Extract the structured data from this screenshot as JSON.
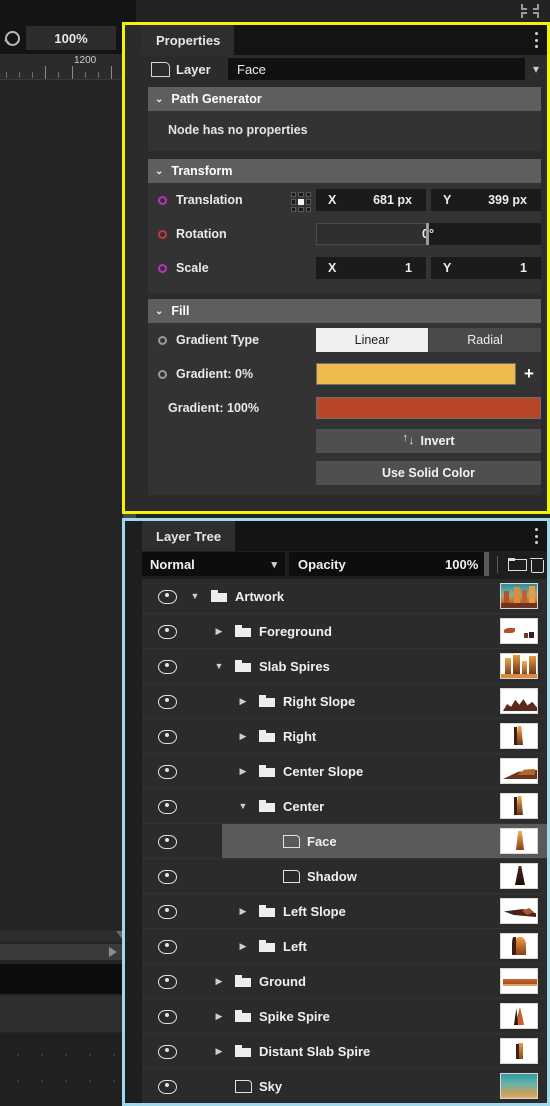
{
  "canvas": {
    "zoom_value": "100%",
    "zoom_icon": "magnifier-icon",
    "ruler_label": "1200",
    "collapse_icon": "collapse-corners-icon"
  },
  "properties_panel": {
    "tab_label": "Properties",
    "menu_icon": "kebab-menu-icon",
    "layer_row": {
      "icon": "path-node-icon",
      "label": "Layer",
      "value": "Face",
      "caret_icon": "chevron-down-icon"
    },
    "sections": [
      {
        "title": "Path Generator",
        "chevron": "⌄",
        "note": "Node has no properties"
      },
      {
        "title": "Transform",
        "chevron": "⌄",
        "rows": {
          "translation": {
            "label": "Translation",
            "anchor_icon": "anchor-point-grid-icon",
            "x_axis": "X",
            "x_value": "681 px",
            "y_axis": "Y",
            "y_value": "399 px"
          },
          "rotation": {
            "label": "Rotation",
            "value": "0°"
          },
          "scale": {
            "label": "Scale",
            "x_axis": "X",
            "x_value": "1",
            "y_axis": "Y",
            "y_value": "1"
          }
        }
      },
      {
        "title": "Fill",
        "chevron": "⌄",
        "gradient_type": {
          "label": "Gradient Type",
          "options": [
            "Linear",
            "Radial"
          ],
          "selected": "Linear"
        },
        "gradient_stop_0": {
          "label": "Gradient: 0%",
          "color": "#EDBB4E",
          "add_icon": "plus-icon"
        },
        "gradient_stop_100": {
          "label": "Gradient: 100%",
          "color": "#B8462A"
        },
        "invert_button": {
          "label": "Invert",
          "icon": "up-down-arrows-icon"
        },
        "solid_button": {
          "label": "Use Solid Color"
        }
      }
    ]
  },
  "layer_tree_panel": {
    "tab_label": "Layer Tree",
    "menu_icon": "kebab-menu-icon",
    "toolbar": {
      "blend_mode": "Normal",
      "blend_caret_icon": "chevron-down-icon",
      "opacity_label": "Opacity",
      "opacity_value": "100%",
      "new_folder_icon": "folder-icon",
      "delete_icon": "trash-icon"
    },
    "rows": [
      {
        "name": "Artwork",
        "indent": 0,
        "type": "folder",
        "expanded": true,
        "visible": true,
        "selected": false,
        "thumb": "artwork"
      },
      {
        "name": "Foreground",
        "indent": 1,
        "type": "folder",
        "expanded": false,
        "visible": true,
        "selected": false,
        "thumb": "foreground"
      },
      {
        "name": "Slab Spires",
        "indent": 1,
        "type": "folder",
        "expanded": true,
        "visible": true,
        "selected": false,
        "thumb": "slabspires"
      },
      {
        "name": "Right Slope",
        "indent": 2,
        "type": "folder",
        "expanded": false,
        "visible": true,
        "selected": false,
        "thumb": "rightslope"
      },
      {
        "name": "Right",
        "indent": 2,
        "type": "folder",
        "expanded": false,
        "visible": true,
        "selected": false,
        "thumb": "spire"
      },
      {
        "name": "Center Slope",
        "indent": 2,
        "type": "folder",
        "expanded": false,
        "visible": true,
        "selected": false,
        "thumb": "slope"
      },
      {
        "name": "Center",
        "indent": 2,
        "type": "folder",
        "expanded": true,
        "visible": true,
        "selected": false,
        "thumb": "spire"
      },
      {
        "name": "Face",
        "indent": 3,
        "type": "path",
        "expanded": null,
        "visible": true,
        "selected": true,
        "thumb": "face"
      },
      {
        "name": "Shadow",
        "indent": 3,
        "type": "path",
        "expanded": null,
        "visible": true,
        "selected": false,
        "thumb": "shadow"
      },
      {
        "name": "Left Slope",
        "indent": 2,
        "type": "folder",
        "expanded": false,
        "visible": true,
        "selected": false,
        "thumb": "leftslope"
      },
      {
        "name": "Left",
        "indent": 2,
        "type": "folder",
        "expanded": false,
        "visible": true,
        "selected": false,
        "thumb": "left"
      },
      {
        "name": "Ground",
        "indent": 1,
        "type": "folder",
        "expanded": false,
        "visible": true,
        "selected": false,
        "thumb": "ground"
      },
      {
        "name": "Spike Spire",
        "indent": 1,
        "type": "folder",
        "expanded": false,
        "visible": true,
        "selected": false,
        "thumb": "spike"
      },
      {
        "name": "Distant Slab Spire",
        "indent": 1,
        "type": "folder",
        "expanded": false,
        "visible": true,
        "selected": false,
        "thumb": "distant"
      },
      {
        "name": "Sky",
        "indent": 1,
        "type": "path",
        "expanded": null,
        "visible": true,
        "selected": false,
        "thumb": "sky"
      }
    ]
  },
  "colors": {
    "properties_border": "#f2f20b",
    "tree_border": "#9fd8ea",
    "gradient_start": "#EDBB4E",
    "gradient_end": "#B8462A"
  }
}
